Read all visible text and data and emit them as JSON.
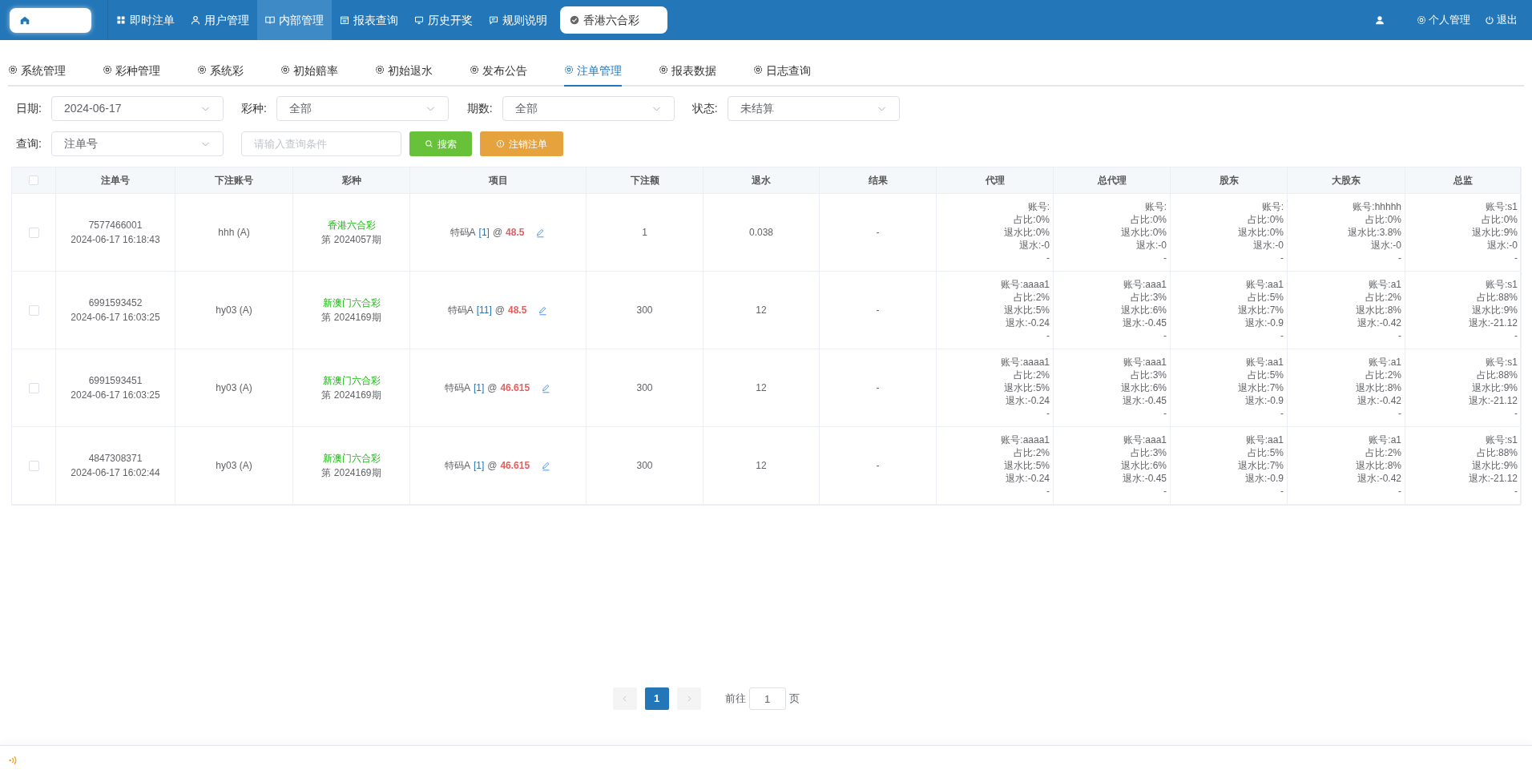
{
  "topnav": {
    "items": [
      {
        "label": "即时注单",
        "selected": false
      },
      {
        "label": "用户管理",
        "selected": false
      },
      {
        "label": "内部管理",
        "selected": true
      },
      {
        "label": "报表查询",
        "selected": false
      },
      {
        "label": "历史开奖",
        "selected": false
      },
      {
        "label": "规则说明",
        "selected": false
      }
    ],
    "lottery_badge": "香港六合彩",
    "right": [
      {
        "label": "个人管理"
      },
      {
        "label": "退出"
      }
    ]
  },
  "subtabs": [
    {
      "label": "系统管理",
      "selected": false
    },
    {
      "label": "彩种管理",
      "selected": false
    },
    {
      "label": "系统彩",
      "selected": false
    },
    {
      "label": "初始赔率",
      "selected": false
    },
    {
      "label": "初始退水",
      "selected": false
    },
    {
      "label": "发布公告",
      "selected": false
    },
    {
      "label": "注单管理",
      "selected": true
    },
    {
      "label": "报表数据",
      "selected": false
    },
    {
      "label": "日志查询",
      "selected": false
    }
  ],
  "filters": [
    {
      "label": "日期:",
      "value": "2024-06-17"
    },
    {
      "label": "彩种:",
      "value": "全部"
    },
    {
      "label": "期数:",
      "value": "全部"
    },
    {
      "label": "状态:",
      "value": "未结算"
    }
  ],
  "query": {
    "label": "查询:",
    "value": "注单号",
    "placeholder": "请输入查询条件",
    "search_button": "搜索",
    "cancel_button": "注销注单"
  },
  "table": {
    "select_all_checked": false,
    "columns": [
      "注单号",
      "下注账号",
      "彩种",
      "项目",
      "下注额",
      "退水",
      "结果",
      "代理",
      "总代理",
      "股东",
      "大股东",
      "总监"
    ],
    "rows": [
      {
        "checked": false,
        "order_no": "7577466001",
        "time": "2024-06-17 16:18:43",
        "account": "hhh (A)",
        "lottery": "香港六合彩",
        "issue": "第 2024057期",
        "item": "特码A",
        "number": "[1]",
        "at": "@",
        "odds": "48.5",
        "amount": "1",
        "rebate": "0.038",
        "result": "-",
        "levels": [
          [
            "账号:",
            "占比:0%",
            "退水比:0%",
            "退水:-0",
            "-"
          ],
          [
            "账号:",
            "占比:0%",
            "退水比:0%",
            "退水:-0",
            "-"
          ],
          [
            "账号:",
            "占比:0%",
            "退水比:0%",
            "退水:-0",
            "-"
          ],
          [
            "账号:hhhhh",
            "占比:0%",
            "退水比:3.8%",
            "退水:-0",
            "-"
          ],
          [
            "账号:s1",
            "占比:0%",
            "退水比:9%",
            "退水:-0",
            "-"
          ]
        ]
      },
      {
        "checked": false,
        "order_no": "6991593452",
        "time": "2024-06-17 16:03:25",
        "account": "hy03 (A)",
        "lottery": "新澳门六合彩",
        "issue": "第 2024169期",
        "item": "特码A",
        "number": "[11]",
        "at": "@",
        "odds": "48.5",
        "amount": "300",
        "rebate": "12",
        "result": "-",
        "levels": [
          [
            "账号:aaaa1",
            "占比:2%",
            "退水比:5%",
            "退水:-0.24",
            "-"
          ],
          [
            "账号:aaa1",
            "占比:3%",
            "退水比:6%",
            "退水:-0.45",
            "-"
          ],
          [
            "账号:aa1",
            "占比:5%",
            "退水比:7%",
            "退水:-0.9",
            "-"
          ],
          [
            "账号:a1",
            "占比:2%",
            "退水比:8%",
            "退水:-0.42",
            "-"
          ],
          [
            "账号:s1",
            "占比:88%",
            "退水比:9%",
            "退水:-21.12",
            "-"
          ]
        ]
      },
      {
        "checked": false,
        "order_no": "6991593451",
        "time": "2024-06-17 16:03:25",
        "account": "hy03 (A)",
        "lottery": "新澳门六合彩",
        "issue": "第 2024169期",
        "item": "特码A",
        "number": "[1]",
        "at": "@",
        "odds": "46.615",
        "amount": "300",
        "rebate": "12",
        "result": "-",
        "levels": [
          [
            "账号:aaaa1",
            "占比:2%",
            "退水比:5%",
            "退水:-0.24",
            "-"
          ],
          [
            "账号:aaa1",
            "占比:3%",
            "退水比:6%",
            "退水:-0.45",
            "-"
          ],
          [
            "账号:aa1",
            "占比:5%",
            "退水比:7%",
            "退水:-0.9",
            "-"
          ],
          [
            "账号:a1",
            "占比:2%",
            "退水比:8%",
            "退水:-0.42",
            "-"
          ],
          [
            "账号:s1",
            "占比:88%",
            "退水比:9%",
            "退水:-21.12",
            "-"
          ]
        ]
      },
      {
        "checked": false,
        "order_no": "4847308371",
        "time": "2024-06-17 16:02:44",
        "account": "hy03 (A)",
        "lottery": "新澳门六合彩",
        "issue": "第 2024169期",
        "item": "特码A",
        "number": "[1]",
        "at": "@",
        "odds": "46.615",
        "amount": "300",
        "rebate": "12",
        "result": "-",
        "levels": [
          [
            "账号:aaaa1",
            "占比:2%",
            "退水比:5%",
            "退水:-0.24",
            "-"
          ],
          [
            "账号:aaa1",
            "占比:3%",
            "退水比:6%",
            "退水:-0.45",
            "-"
          ],
          [
            "账号:aa1",
            "占比:5%",
            "退水比:7%",
            "退水:-0.9",
            "-"
          ],
          [
            "账号:a1",
            "占比:2%",
            "退水比:8%",
            "退水:-0.42",
            "-"
          ],
          [
            "账号:s1",
            "占比:88%",
            "退水比:9%",
            "退水:-21.12",
            "-"
          ]
        ]
      }
    ]
  },
  "pagination": {
    "pages": [
      {
        "label": "1",
        "selected": true
      }
    ],
    "goto_label": "前往",
    "goto_value": "1",
    "page_suffix": "页"
  }
}
